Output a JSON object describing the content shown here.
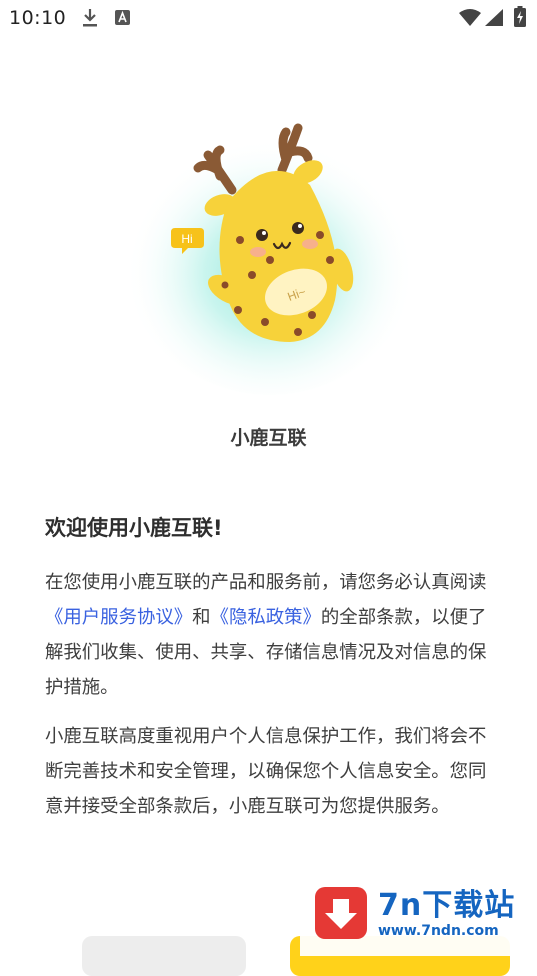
{
  "status_bar": {
    "time": "10:10",
    "icons": [
      "download-icon",
      "a-notification-icon",
      "wifi-icon",
      "signal-icon",
      "battery-charging-icon"
    ]
  },
  "mascot": {
    "badge_left": "Hi",
    "badge_belly": "Hi~"
  },
  "app_name": "小鹿互联",
  "welcome": {
    "title": "欢迎使用小鹿互联!",
    "p1_before": "在您使用小鹿互联的产品和服务前，请您务必认真阅读",
    "link_service": "《用户服务协议》",
    "p1_and": "和",
    "link_privacy": "《隐私政策》",
    "p1_after": "的全部条款，以便了解我们收集、使用、共享、存储信息情况及对信息的保护措施。",
    "p2": "小鹿互联高度重视用户个人信息保护工作，我们将会不断完善技术和安全管理，以确保您个人信息安全。您同意并接受全部条款后，小鹿互联可为您提供服务。"
  },
  "watermark": {
    "title": "7n下载站",
    "url": "www.7ndn.com"
  },
  "colors": {
    "link": "#3a62e0",
    "agree_button": "#ffd21a",
    "mascot_yellow": "#f7d23a",
    "glow": "#7fe3d4"
  }
}
